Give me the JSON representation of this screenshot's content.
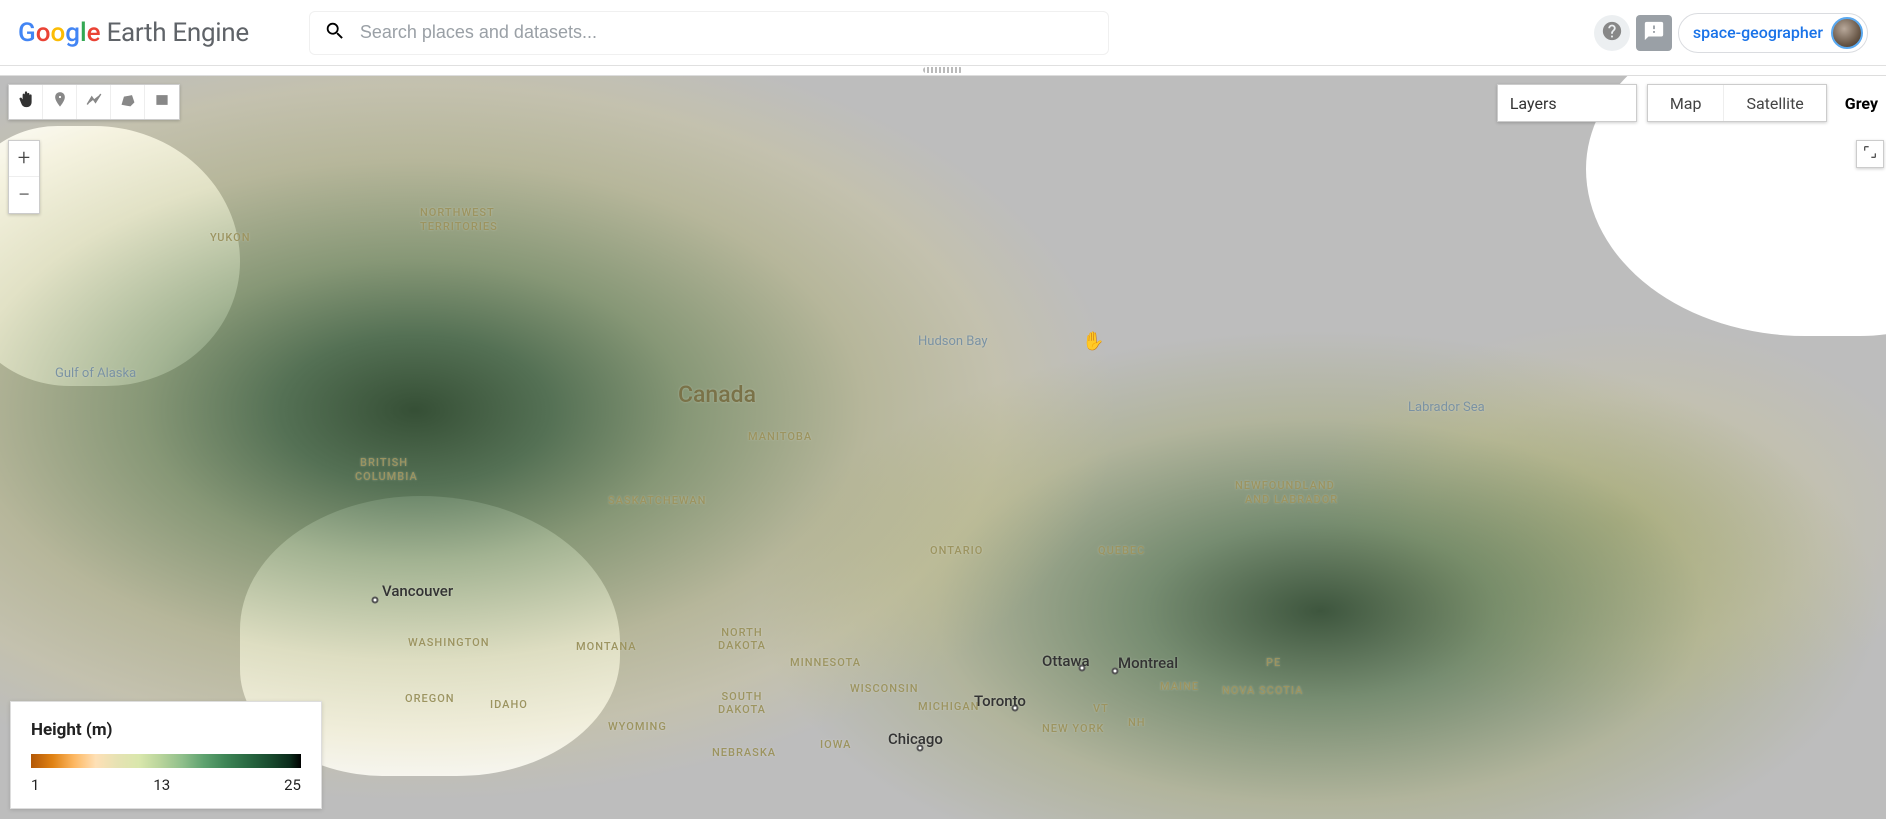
{
  "header": {
    "logo_google_letters": [
      "G",
      "o",
      "o",
      "g",
      "l",
      "e"
    ],
    "logo_product": "Earth Engine",
    "search_placeholder": "Search places and datasets...",
    "username": "space-geographer"
  },
  "toolbar": {
    "layers_label": "Layers",
    "map_tab": "Map",
    "satellite_tab": "Satellite",
    "grey_tab": "Grey",
    "zoom_in": "+",
    "zoom_out": "−"
  },
  "legend": {
    "title": "Height (m)",
    "min": "1",
    "mid": "13",
    "max": "25",
    "palette": [
      "#b35806",
      "#e08214",
      "#fdb863",
      "#fee0b6",
      "#e6e2b3",
      "#d9e7ac",
      "#b8d49b",
      "#8fbf8b",
      "#5ea26f",
      "#3e8556",
      "#2a6a43",
      "#1a4d30",
      "#0a2a1a",
      "#000000"
    ]
  },
  "map_labels": {
    "country": "Canada",
    "water": {
      "gulf_alaska": "Gulf of Alaska",
      "hudson_bay": "Hudson Bay",
      "labrador_sea": "Labrador Sea"
    },
    "provinces": {
      "yukon": "YUKON",
      "nwt1": "NORTHWEST",
      "nwt2": "TERRITORIES",
      "bc1": "BRITISH",
      "bc2": "COLUMBIA",
      "manitoba": "MANITOBA",
      "saskatchewan": "SASKATCHEWAN",
      "ontario": "ONTARIO",
      "quebec": "QUEBEC",
      "nl1": "NEWFOUNDLAND",
      "nl2": "AND LABRADOR",
      "pe": "PE",
      "ns": "NOVA SCOTIA",
      "vt": "VT",
      "nh": "NH",
      "maine": "MAINE"
    },
    "us_states": {
      "washington": "WASHINGTON",
      "oregon": "OREGON",
      "idaho": "IDAHO",
      "montana": "MONTANA",
      "wyoming": "WYOMING",
      "nd": "NORTH\nDAKOTA",
      "sd": "SOUTH\nDAKOTA",
      "mn": "MINNESOTA",
      "wi": "WISCONSIN",
      "mi": "MICHIGAN",
      "ia": "IOWA",
      "ne": "NEBRASKA",
      "ny": "NEW YORK"
    },
    "cities": {
      "vancouver": "Vancouver",
      "ottawa": "Ottawa",
      "montreal": "Montreal",
      "toronto": "Toronto",
      "chicago": "Chicago"
    }
  },
  "chart_data": {
    "type": "heatmap",
    "title": "Height (m)",
    "value_label": "Height (m)",
    "value_range": [
      1,
      25
    ],
    "legend_ticks": [
      1,
      13,
      25
    ],
    "palette": [
      "#b35806",
      "#e08214",
      "#fdb863",
      "#fee0b6",
      "#e6e2b3",
      "#d9e7ac",
      "#b8d49b",
      "#8fbf8b",
      "#5ea26f",
      "#3e8556",
      "#2a6a43",
      "#1a4d30",
      "#0a2a1a",
      "#000000"
    ],
    "region": "Canada / northern United States",
    "basemap": "Grey"
  }
}
